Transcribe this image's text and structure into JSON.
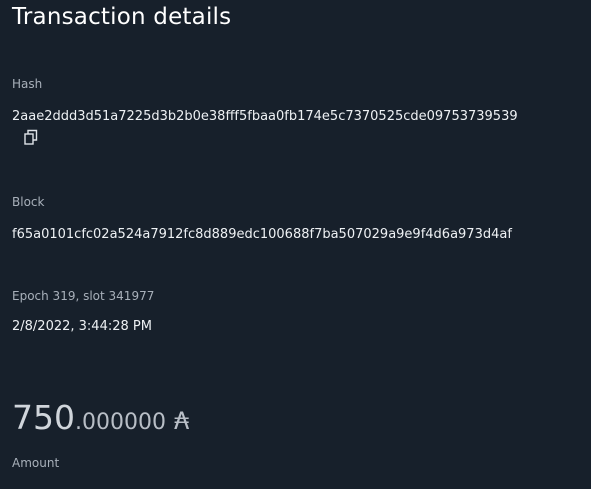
{
  "page": {
    "title": "Transaction details"
  },
  "hash": {
    "label": "Hash",
    "value": "2aae2ddd3d51a7225d3b2b0e38fff5fbaa0fb174e5c7370525cde09753739539",
    "copy_icon": "copy-icon"
  },
  "block": {
    "label": "Block",
    "value": "f65a0101cfc02a524a7912fc8d889edc100688f7ba507029a9e9f4d6a973d4af"
  },
  "epoch": {
    "label": "Epoch 319, slot 341977",
    "timestamp": "2/8/2022, 3:44:28 PM"
  },
  "amount": {
    "integer": "750",
    "decimal": ".000000",
    "currency_symbol": "₳",
    "label": "Amount"
  }
}
